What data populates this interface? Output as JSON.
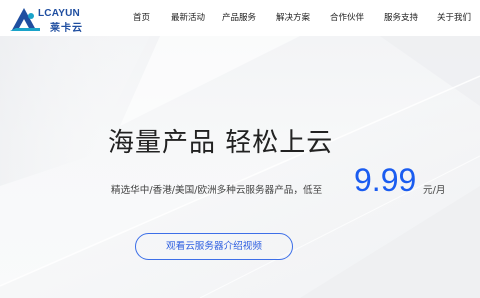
{
  "brand": {
    "name_en": "LCAYUN",
    "name_cn": "莱卡云",
    "logo_icon": "mountain-logo-icon"
  },
  "nav": {
    "items": [
      "首页",
      "最新活动",
      "产品服务",
      "解决方案",
      "合作伙伴",
      "服务支持",
      "关于我们"
    ]
  },
  "hero": {
    "title": "海量产品 轻松上云",
    "subtitle": "精选华中/香港/美国/欧洲多种云服务器产品，低至",
    "price": "9.99",
    "unit": "元/月",
    "video_button": "观看云服务器介绍视频"
  },
  "colors": {
    "accent": "#1a5cf0",
    "button_border": "#3d6fe8",
    "logo": "#1f4ea0"
  }
}
